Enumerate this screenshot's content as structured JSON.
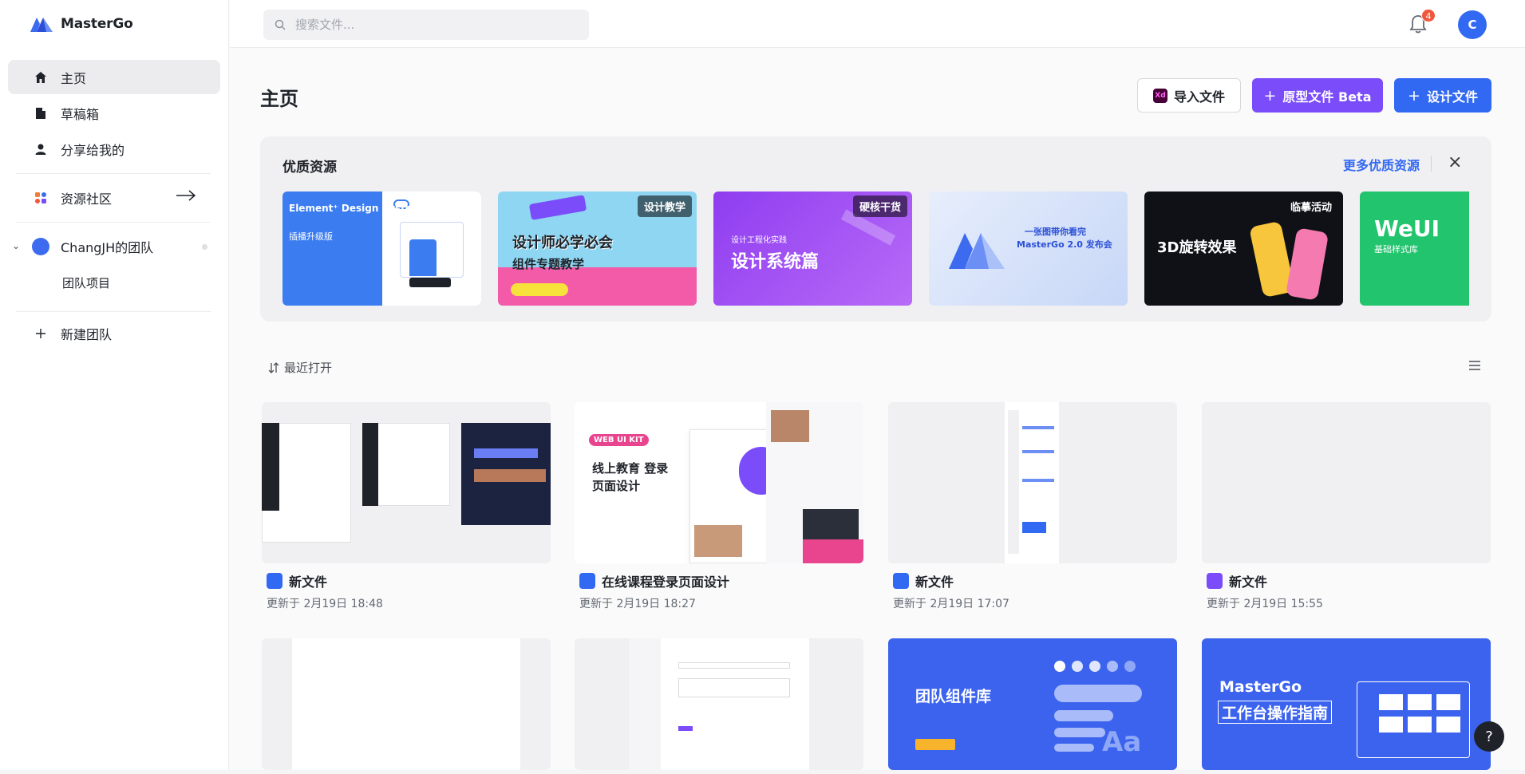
{
  "app": {
    "name": "MasterGo"
  },
  "sidebar": {
    "items": [
      {
        "label": "主页",
        "icon": "home-icon",
        "active": true
      },
      {
        "label": "草稿箱",
        "icon": "file-icon"
      },
      {
        "label": "分享给我的",
        "icon": "user-icon"
      },
      {
        "label": "资源社区",
        "icon": "community-icon"
      }
    ],
    "team": {
      "name": "ChangJH的团队",
      "sub_item": "团队项目"
    },
    "new_team": "新建团队"
  },
  "topbar": {
    "search_placeholder": "搜索文件...",
    "notification_count": "4",
    "avatar_letter": "C"
  },
  "main": {
    "title": "主页",
    "buttons": {
      "import": "导入文件",
      "prototype": "原型文件 Beta",
      "design": "设计文件"
    },
    "resources": {
      "title": "优质资源",
      "more": "更多优质资源",
      "cards": [
        {
          "title": "Element⁺ Design System",
          "subtitle": "插播升级版",
          "tag": ""
        },
        {
          "title": "设计师必学必会",
          "subtitle": "组件专题教学",
          "tag": "设计教学"
        },
        {
          "title": "设计系统篇",
          "subtitle": "设计工程化实践",
          "tag": "硬核干货"
        },
        {
          "title": "一张图带你看完",
          "subtitle": "MasterGo 2.0 发布会",
          "tag": ""
        },
        {
          "title": "3D旋转效果",
          "subtitle": "",
          "tag": "临摹活动"
        },
        {
          "title": "WeUI",
          "subtitle": "基础样式库",
          "tag": ""
        }
      ]
    },
    "recent": {
      "label": "最近打开",
      "files": [
        {
          "name": "新文件",
          "date": "更新于 2月19日 18:48",
          "type": "design"
        },
        {
          "name": "在线课程登录页面设计",
          "date": "更新于 2月19日 18:27",
          "type": "design"
        },
        {
          "name": "新文件",
          "date": "更新于 2月19日 17:07",
          "type": "design"
        },
        {
          "name": "新文件",
          "date": "更新于 2月19日 15:55",
          "type": "prototype"
        }
      ],
      "thumb_texts": {
        "edu_kit": "WEB UI KIT",
        "edu_title": "线上教育 登录页面设计",
        "team_lib": "团队组件库",
        "guide_brand": "MasterGo",
        "guide_title": "工作台操作指南"
      }
    },
    "help": "?"
  },
  "colors": {
    "primary": "#3269f3",
    "prototype": "#7a4cfa",
    "badge": "#f0583d"
  }
}
